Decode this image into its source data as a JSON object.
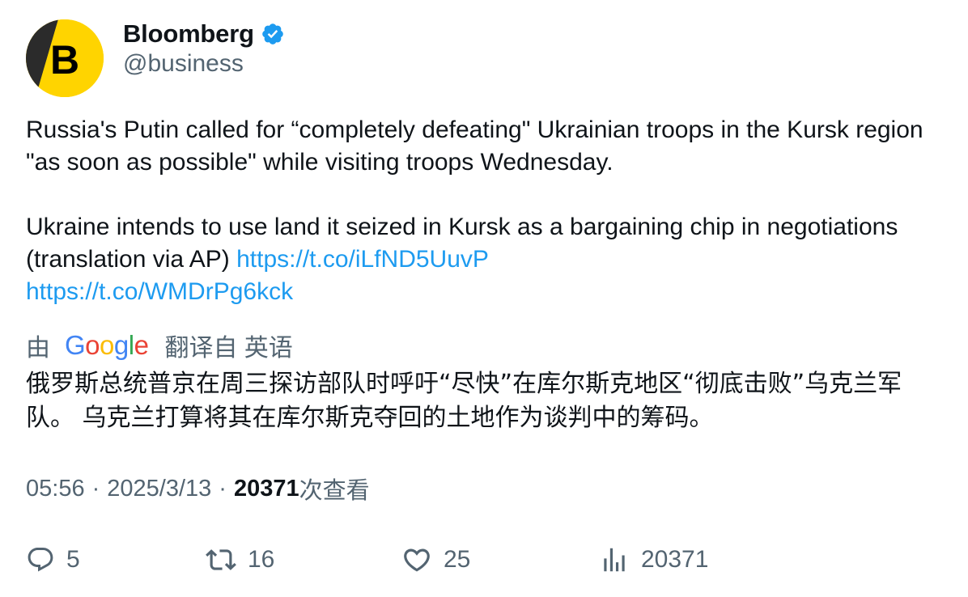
{
  "author": {
    "name": "Bloomberg",
    "handle": "@business",
    "avatar_letter": "B",
    "verified": true
  },
  "tweet": {
    "paragraph1": "Russia's Putin called for “completely defeating\" Ukrainian troops in the Kursk region \"as soon as possible\" while visiting troops Wednesday.",
    "paragraph2_text": "Ukraine intends to use land it seized in Kursk as a bargaining chip in negotiations (translation via AP) ",
    "link1": "https://t.co/iLfND5UuvP",
    "link2": "https://t.co/WMDrPg6kck"
  },
  "translation": {
    "prefix": "由",
    "provider": "Google",
    "suffix": "翻译自 英语",
    "text": "俄罗斯总统普京在周三探访部队时呼吁“尽快”在库尔斯克地区“彻底击败”乌克兰军队。 乌克兰打算将其在库尔斯克夺回的土地作为谈判中的筹码。"
  },
  "meta": {
    "time": "05:56",
    "separator": "·",
    "date": "2025/3/13",
    "views": "20371",
    "views_label": "次查看"
  },
  "actions": {
    "replies": "5",
    "retweets": "16",
    "likes": "25",
    "views": "20371"
  },
  "colors": {
    "link": "#1d9bf0",
    "secondary_text": "#536471",
    "primary_text": "#0f1419",
    "verified_badge": "#1d9bf0",
    "avatar_background": "#ffd400"
  },
  "icons": {
    "verified": "verified-badge-icon",
    "reply": "reply-icon",
    "retweet": "retweet-icon",
    "like": "heart-icon",
    "views": "bar-chart-icon"
  }
}
